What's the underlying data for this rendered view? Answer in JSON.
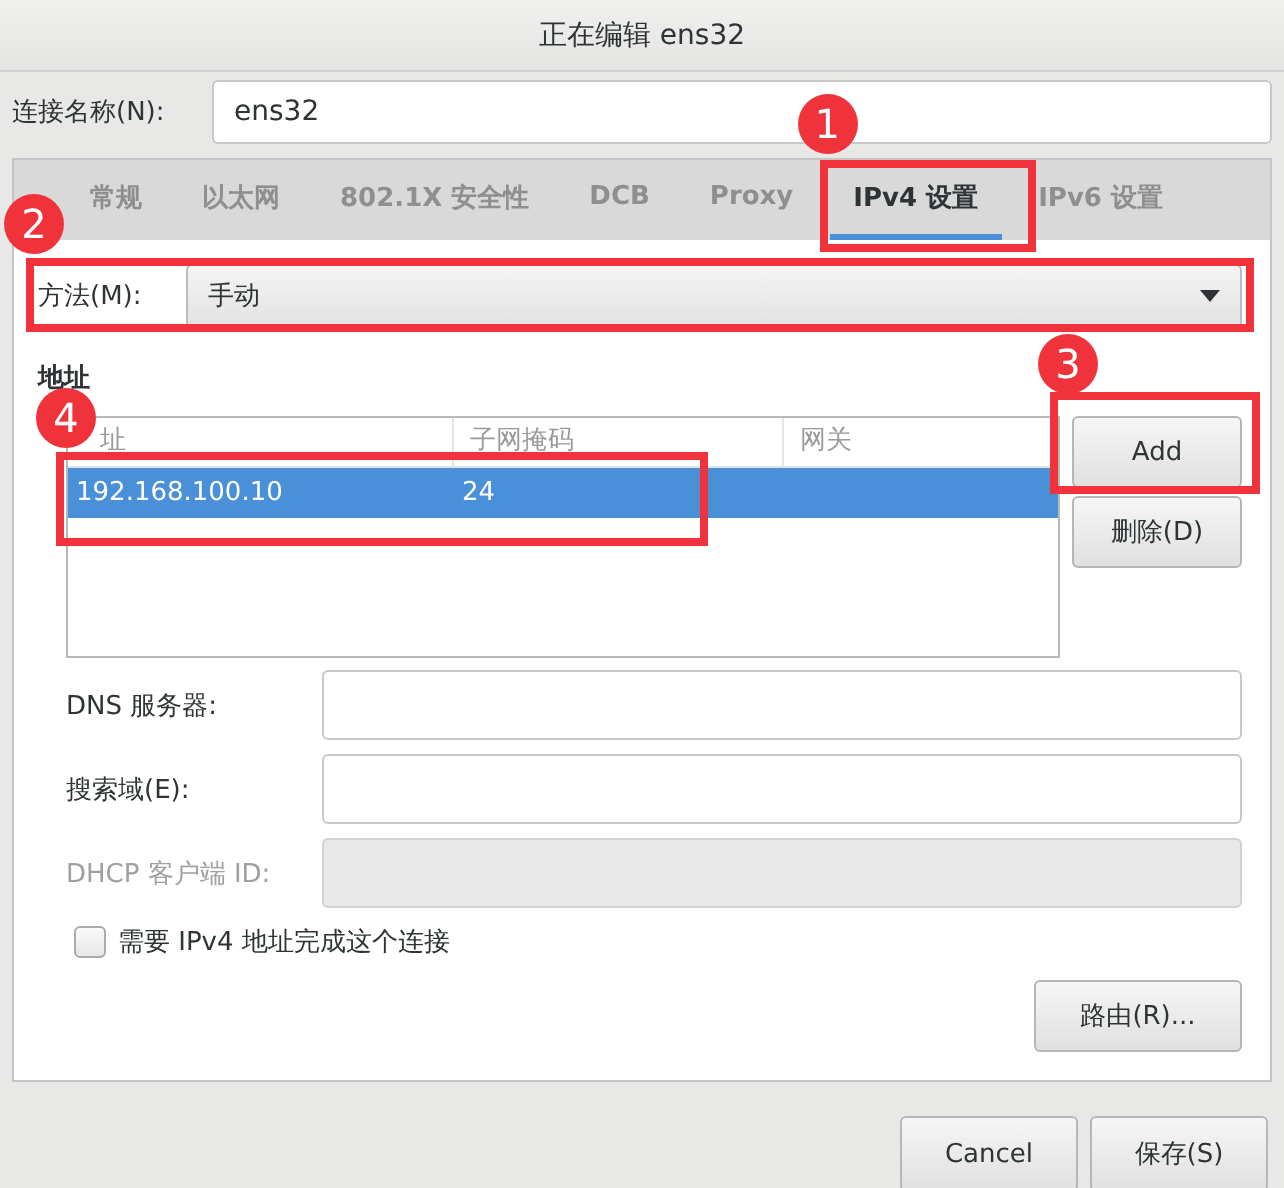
{
  "window": {
    "title": "正在编辑 ens32"
  },
  "connection_name": {
    "label": "连接名称(N):",
    "value": "ens32"
  },
  "tabs": [
    {
      "label": "常规",
      "selected": false
    },
    {
      "label": "以太网",
      "selected": false
    },
    {
      "label": "802.1X 安全性",
      "selected": false
    },
    {
      "label": "DCB",
      "selected": false
    },
    {
      "label": "Proxy",
      "selected": false
    },
    {
      "label": "IPv4 设置",
      "selected": true,
      "callout": "1"
    },
    {
      "label": "IPv6 设置",
      "selected": false
    }
  ],
  "method": {
    "label": "方法(M):",
    "value": "手动",
    "callout": "2"
  },
  "addresses": {
    "heading": "地址",
    "columns": [
      "址",
      "子网掩码",
      "网关"
    ],
    "rows": [
      {
        "cells": [
          "192.168.100.10",
          "24"
        ],
        "selected": true,
        "callout": "4"
      }
    ],
    "buttons": [
      {
        "label": "Add",
        "callout": "3"
      },
      {
        "label": "删除(D)"
      }
    ]
  },
  "fields": [
    {
      "label": "DNS 服务器:",
      "disabled": false
    },
    {
      "label": "搜索域(E):",
      "disabled": false
    },
    {
      "label": "DHCP 客户端 ID:",
      "disabled": true
    }
  ],
  "require_ipv4": {
    "label": "需要 IPv4 地址完成这个连接",
    "checked": false
  },
  "routes_button": "路由(R)...",
  "dialog_buttons": [
    "Cancel",
    "保存(S)"
  ]
}
